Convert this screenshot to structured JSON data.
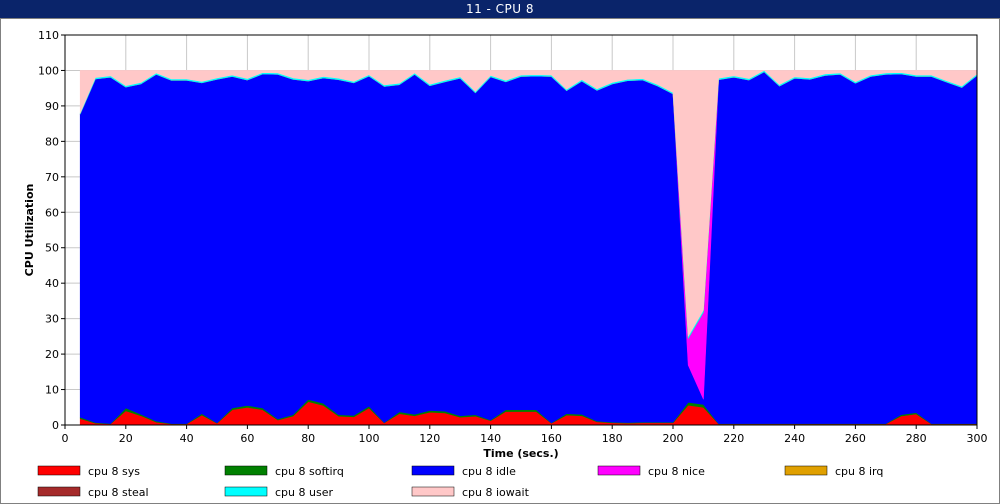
{
  "window": {
    "title": "11 - CPU 8"
  },
  "chart_data": {
    "type": "area",
    "stacked": true,
    "xlabel": "Time (secs.)",
    "ylabel": "CPU Utilization",
    "xlim": [
      0,
      300
    ],
    "ylim": [
      0,
      110
    ],
    "x_ticks": [
      0,
      20,
      40,
      60,
      80,
      100,
      120,
      140,
      160,
      180,
      200,
      220,
      240,
      260,
      280,
      300
    ],
    "y_ticks": [
      0,
      10,
      20,
      30,
      40,
      50,
      60,
      70,
      80,
      90,
      100,
      110
    ],
    "grid": true,
    "legend_position": "bottom",
    "x": [
      5,
      10,
      15,
      20,
      25,
      30,
      35,
      40,
      45,
      50,
      55,
      60,
      65,
      70,
      75,
      80,
      85,
      90,
      95,
      100,
      105,
      110,
      115,
      120,
      125,
      130,
      135,
      140,
      145,
      150,
      155,
      160,
      165,
      170,
      175,
      180,
      185,
      190,
      195,
      200,
      205,
      210,
      215,
      220,
      225,
      230,
      235,
      240,
      245,
      250,
      255,
      260,
      265,
      270,
      275,
      280,
      285,
      290,
      295,
      300
    ],
    "series": [
      {
        "name": "cpu 8 sys",
        "color": "#ff0000",
        "values": [
          1.8,
          0.5,
          0.3,
          4,
          2.6,
          0.8,
          0.3,
          0.3,
          2.8,
          0.5,
          4.3,
          5,
          4.3,
          1.4,
          2.5,
          6.6,
          5.5,
          2.5,
          2.3,
          4.8,
          0.6,
          3.2,
          2.6,
          3.6,
          3.4,
          2.2,
          2.5,
          1.2,
          3.8,
          3.8,
          3.8,
          0.5,
          2.8,
          2.6,
          0.9,
          0.6,
          0.5,
          0.6,
          0.6,
          0.6,
          5.6,
          5,
          0.3,
          0.3,
          0.3,
          0.3,
          0.3,
          0.3,
          0.3,
          0.3,
          0.3,
          0.3,
          0.3,
          0.3,
          2.5,
          3.1,
          0.3,
          0.3,
          0.3,
          0.3
        ]
      },
      {
        "name": "cpu 8 softirq",
        "color": "#008000",
        "values": [
          0.4,
          0.2,
          0.1,
          0.8,
          0.4,
          0.3,
          0.1,
          0.1,
          0.4,
          0.1,
          0.5,
          0.5,
          0.5,
          0.3,
          0.4,
          0.6,
          0.6,
          0.4,
          0.4,
          0.5,
          0.1,
          0.5,
          0.4,
          0.5,
          0.5,
          0.4,
          0.4,
          0.2,
          0.5,
          0.5,
          0.5,
          0.1,
          0.4,
          0.4,
          0.2,
          0.2,
          0.2,
          0.2,
          0.2,
          0.2,
          0.8,
          0.8,
          0.1,
          0.1,
          0.1,
          0.1,
          0.1,
          0.1,
          0.1,
          0.1,
          0.1,
          0.1,
          0.1,
          0.1,
          0.4,
          0.4,
          0.1,
          0.1,
          0.1,
          0.1
        ]
      },
      {
        "name": "cpu 8 idle",
        "color": "#0000ff",
        "values": [
          85.5,
          96.9,
          97.7,
          90.5,
          93.2,
          97.8,
          96.8,
          96.8,
          93.3,
          96.9,
          93.5,
          91.8,
          94.2,
          97.2,
          94.6,
          89.8,
          91.8,
          94.5,
          93.8,
          93.1,
          94.8,
          92.3,
          95.9,
          91.6,
          92.9,
          95.2,
          90.8,
          96.8,
          92.5,
          94,
          94.1,
          97.7,
          91.1,
          94,
          93.3,
          95.4,
          96.4,
          96.5,
          94.8,
          92.6,
          10.5,
          1.5,
          97,
          97.7,
          96.9,
          99.2,
          95.2,
          97.4,
          97.1,
          98.2,
          98.5,
          96,
          97.9,
          98.5,
          96.1,
          94.8,
          97.9,
          96.3,
          94.8,
          98.2
        ]
      },
      {
        "name": "cpu 8 nice",
        "color": "#ff00ff",
        "values": [
          0,
          0,
          0,
          0,
          0,
          0,
          0,
          0,
          0,
          0,
          0,
          0,
          0,
          0,
          0,
          0,
          0,
          0,
          0,
          0,
          0,
          0,
          0,
          0,
          0,
          0,
          0,
          0,
          0,
          0,
          0,
          0,
          0,
          0,
          0,
          0,
          0,
          0,
          0,
          0,
          7.5,
          24.5,
          0,
          0,
          0,
          0,
          0,
          0,
          0,
          0,
          0,
          0,
          0,
          0,
          0,
          0,
          0,
          0,
          0,
          0
        ]
      },
      {
        "name": "cpu 8 irq",
        "color": "#e0a000",
        "values": [
          0,
          0,
          0,
          0,
          0,
          0,
          0,
          0,
          0,
          0,
          0,
          0,
          0,
          0,
          0,
          0,
          0,
          0,
          0,
          0,
          0,
          0,
          0,
          0,
          0,
          0,
          0,
          0,
          0,
          0,
          0,
          0,
          0,
          0,
          0,
          0,
          0,
          0,
          0,
          0,
          0,
          0,
          0,
          0,
          0,
          0,
          0,
          0,
          0,
          0,
          0,
          0,
          0,
          0,
          0,
          0,
          0,
          0,
          0,
          0
        ]
      },
      {
        "name": "cpu 8 steal",
        "color": "#a52a2a",
        "values": [
          0,
          0,
          0,
          0,
          0,
          0,
          0,
          0,
          0,
          0,
          0,
          0,
          0,
          0,
          0,
          0,
          0,
          0,
          0,
          0,
          0,
          0,
          0,
          0,
          0,
          0,
          0,
          0,
          0,
          0,
          0,
          0,
          0,
          0,
          0,
          0,
          0,
          0,
          0,
          0,
          0,
          0,
          0,
          0,
          0,
          0,
          0,
          0,
          0,
          0,
          0,
          0,
          0,
          0,
          0,
          0,
          0,
          0,
          0,
          0
        ]
      },
      {
        "name": "cpu 8 user",
        "color": "#00ffff",
        "values": [
          0.3,
          0.4,
          0.4,
          0.4,
          0.4,
          0.4,
          0.4,
          0.4,
          0.4,
          0.4,
          0.4,
          0.4,
          0.4,
          0.4,
          0.4,
          0.4,
          0.4,
          0.4,
          0.4,
          0.4,
          0.4,
          0.4,
          0.4,
          0.4,
          0.4,
          0.4,
          0.4,
          0.4,
          0.4,
          0.4,
          0.4,
          0.4,
          0.4,
          0.4,
          0.4,
          0.4,
          0.4,
          0.4,
          0.4,
          0.4,
          0.6,
          0.6,
          0.4,
          0.4,
          0.4,
          0.4,
          0.4,
          0.4,
          0.4,
          0.4,
          0.4,
          0.4,
          0.4,
          0.4,
          0.4,
          0.4,
          0.4,
          0.4,
          0.4,
          0.4
        ]
      },
      {
        "name": "cpu 8 iowait",
        "color": "#ffc8c8",
        "values": [
          12,
          2,
          1.5,
          4.3,
          3.4,
          0.7,
          2.4,
          2.4,
          3.1,
          2.1,
          1.3,
          2.3,
          0.6,
          0.7,
          2.1,
          2.6,
          1.7,
          2.2,
          3.1,
          1.2,
          4.1,
          3.6,
          0.7,
          3.9,
          2.8,
          1.8,
          5.9,
          1.4,
          2.8,
          1.3,
          1.2,
          1.3,
          5.3,
          2.6,
          5.2,
          3.4,
          2.5,
          2.3,
          4,
          6.2,
          75,
          67.6,
          2.2,
          1.5,
          2.3,
          0,
          4,
          1.8,
          2.1,
          1,
          0.7,
          3.2,
          1.3,
          0.7,
          0.6,
          1.3,
          1.3,
          2.9,
          4.4,
          1
        ]
      }
    ]
  }
}
